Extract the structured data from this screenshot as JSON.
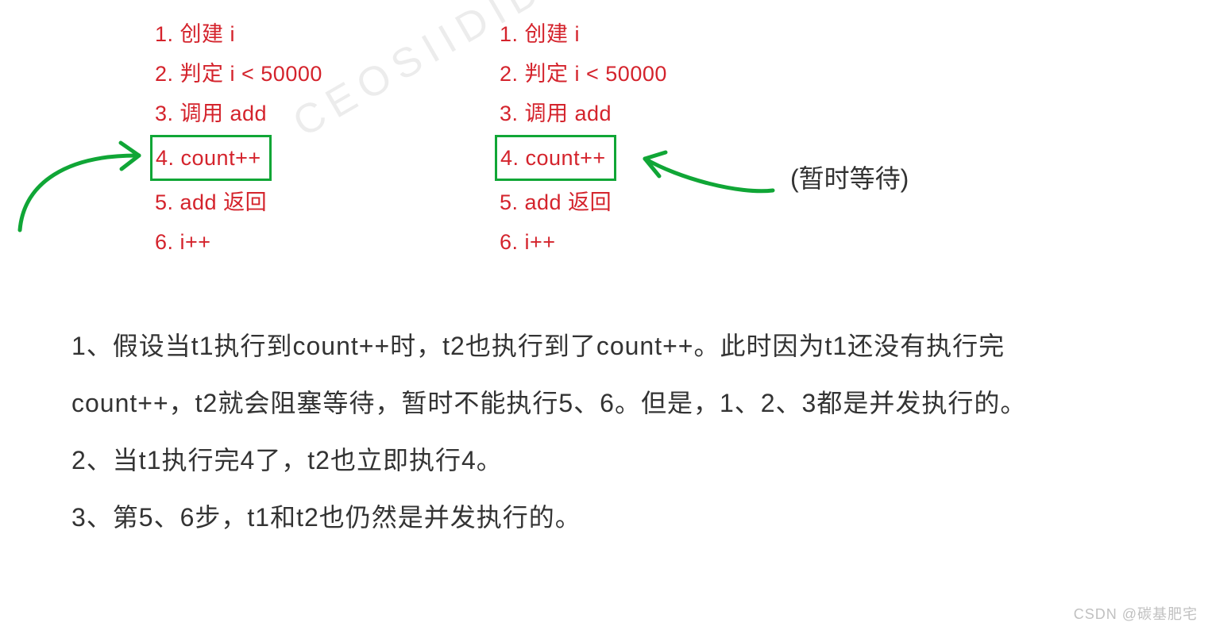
{
  "steps": {
    "s1": "1. 创建 i",
    "s2": "2. 判定 i < 50000",
    "s3": "3. 调用 add",
    "s4": "4. count++",
    "s5": "5. add 返回",
    "s6": "6. i++"
  },
  "annotation": "(暂时等待)",
  "explanation": {
    "p1": "1、假设当t1执行到count++时，t2也执行到了count++。此时因为t1还没有执行完count++，t2就会阻塞等待，暂时不能执行5、6。但是，1、2、3都是并发执行的。",
    "p2": "2、当t1执行完4了，t2也立即执行4。",
    "p3": "3、第5、6步，t1和t2也仍然是并发执行的。"
  },
  "watermark": {
    "main": "CEOSIIDID",
    "footer": "CSDN @碳基肥宅"
  },
  "colors": {
    "step_text": "#d4232c",
    "box_border": "#10a636",
    "arrow": "#10a636",
    "body_text": "#333333"
  }
}
